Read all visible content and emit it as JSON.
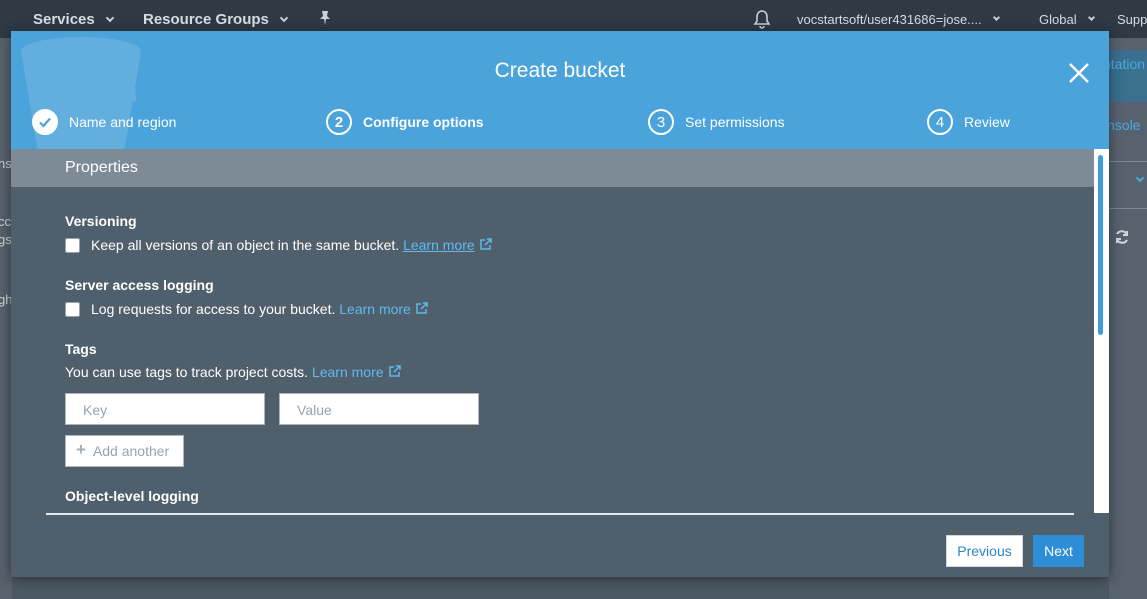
{
  "topnav": {
    "services": "Services",
    "resource_groups": "Resource Groups",
    "account": "vocstartsoft/user431686=jose....",
    "region": "Global",
    "support": "Supp"
  },
  "background": {
    "right_fragments": [
      "ntation",
      "nsole"
    ],
    "left_fragments": [
      "ns",
      "cc",
      "gs",
      "gh"
    ]
  },
  "modal": {
    "title": "Create bucket",
    "steps": [
      {
        "number": "1",
        "label": "Name and region",
        "state": "done"
      },
      {
        "number": "2",
        "label": "Configure options",
        "state": "active"
      },
      {
        "number": "3",
        "label": "Set permissions",
        "state": "pending"
      },
      {
        "number": "4",
        "label": "Review",
        "state": "pending"
      }
    ],
    "section_title": "Properties",
    "versioning": {
      "title": "Versioning",
      "text": "Keep all versions of an object in the same bucket.",
      "link": "Learn more"
    },
    "logging": {
      "title": "Server access logging",
      "text": "Log requests for access to your bucket.",
      "link": "Learn more"
    },
    "tags": {
      "title": "Tags",
      "text": "You can use tags to track project costs.",
      "link": "Learn more",
      "key_placeholder": "Key",
      "value_placeholder": "Value",
      "add_label": "Add another"
    },
    "object_logging": {
      "title": "Object-level logging"
    },
    "previous_label": "Previous",
    "next_label": "Next"
  },
  "colors": {
    "header": "#4aa3db",
    "body": "#4f5f6c",
    "link": "#5fbaf0",
    "primary": "#2d8ed6"
  }
}
